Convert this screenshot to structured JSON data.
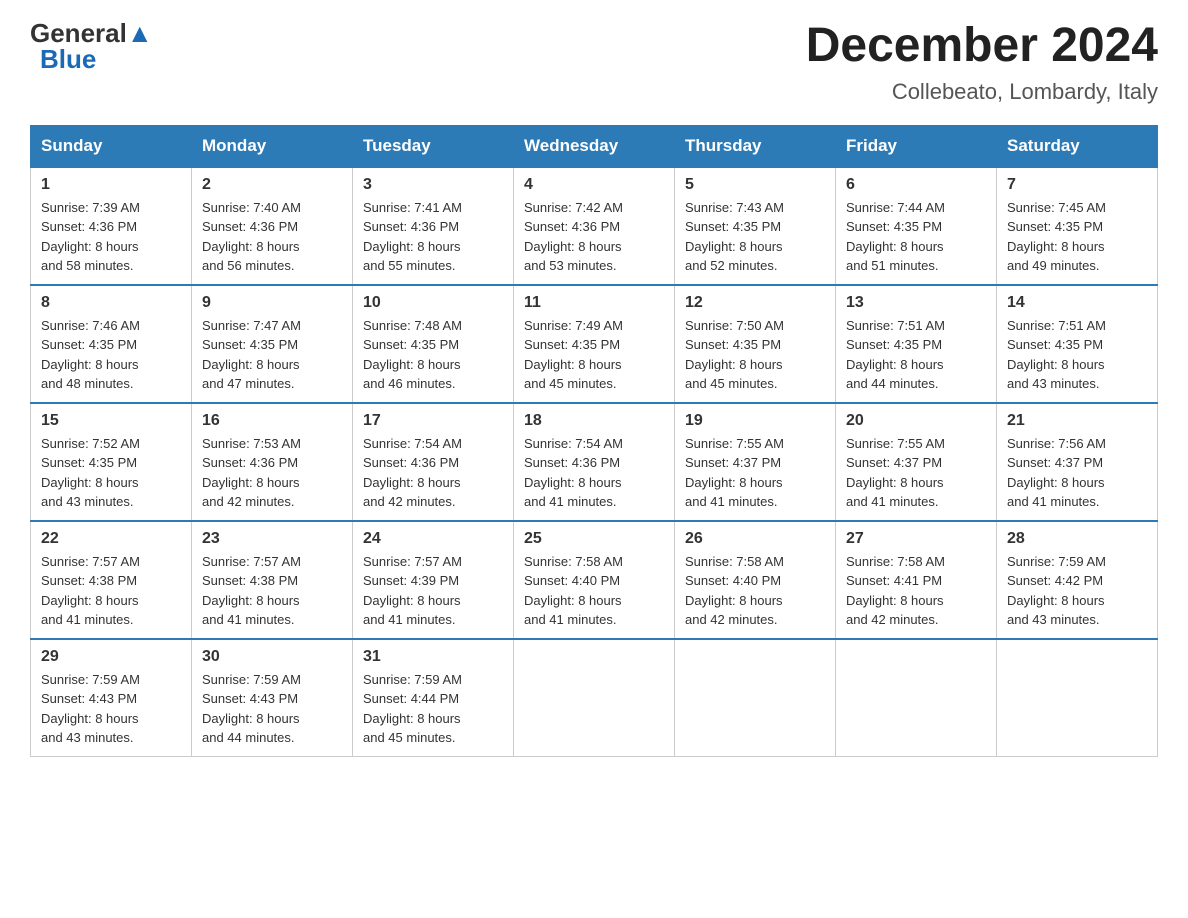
{
  "header": {
    "logo_general": "General",
    "logo_blue": "Blue",
    "month_title": "December 2024",
    "location": "Collebeato, Lombardy, Italy"
  },
  "weekdays": [
    "Sunday",
    "Monday",
    "Tuesday",
    "Wednesday",
    "Thursday",
    "Friday",
    "Saturday"
  ],
  "weeks": [
    [
      {
        "day": "1",
        "sunrise": "7:39 AM",
        "sunset": "4:36 PM",
        "daylight": "8 hours and 58 minutes."
      },
      {
        "day": "2",
        "sunrise": "7:40 AM",
        "sunset": "4:36 PM",
        "daylight": "8 hours and 56 minutes."
      },
      {
        "day": "3",
        "sunrise": "7:41 AM",
        "sunset": "4:36 PM",
        "daylight": "8 hours and 55 minutes."
      },
      {
        "day": "4",
        "sunrise": "7:42 AM",
        "sunset": "4:36 PM",
        "daylight": "8 hours and 53 minutes."
      },
      {
        "day": "5",
        "sunrise": "7:43 AM",
        "sunset": "4:35 PM",
        "daylight": "8 hours and 52 minutes."
      },
      {
        "day": "6",
        "sunrise": "7:44 AM",
        "sunset": "4:35 PM",
        "daylight": "8 hours and 51 minutes."
      },
      {
        "day": "7",
        "sunrise": "7:45 AM",
        "sunset": "4:35 PM",
        "daylight": "8 hours and 49 minutes."
      }
    ],
    [
      {
        "day": "8",
        "sunrise": "7:46 AM",
        "sunset": "4:35 PM",
        "daylight": "8 hours and 48 minutes."
      },
      {
        "day": "9",
        "sunrise": "7:47 AM",
        "sunset": "4:35 PM",
        "daylight": "8 hours and 47 minutes."
      },
      {
        "day": "10",
        "sunrise": "7:48 AM",
        "sunset": "4:35 PM",
        "daylight": "8 hours and 46 minutes."
      },
      {
        "day": "11",
        "sunrise": "7:49 AM",
        "sunset": "4:35 PM",
        "daylight": "8 hours and 45 minutes."
      },
      {
        "day": "12",
        "sunrise": "7:50 AM",
        "sunset": "4:35 PM",
        "daylight": "8 hours and 45 minutes."
      },
      {
        "day": "13",
        "sunrise": "7:51 AM",
        "sunset": "4:35 PM",
        "daylight": "8 hours and 44 minutes."
      },
      {
        "day": "14",
        "sunrise": "7:51 AM",
        "sunset": "4:35 PM",
        "daylight": "8 hours and 43 minutes."
      }
    ],
    [
      {
        "day": "15",
        "sunrise": "7:52 AM",
        "sunset": "4:35 PM",
        "daylight": "8 hours and 43 minutes."
      },
      {
        "day": "16",
        "sunrise": "7:53 AM",
        "sunset": "4:36 PM",
        "daylight": "8 hours and 42 minutes."
      },
      {
        "day": "17",
        "sunrise": "7:54 AM",
        "sunset": "4:36 PM",
        "daylight": "8 hours and 42 minutes."
      },
      {
        "day": "18",
        "sunrise": "7:54 AM",
        "sunset": "4:36 PM",
        "daylight": "8 hours and 41 minutes."
      },
      {
        "day": "19",
        "sunrise": "7:55 AM",
        "sunset": "4:37 PM",
        "daylight": "8 hours and 41 minutes."
      },
      {
        "day": "20",
        "sunrise": "7:55 AM",
        "sunset": "4:37 PM",
        "daylight": "8 hours and 41 minutes."
      },
      {
        "day": "21",
        "sunrise": "7:56 AM",
        "sunset": "4:37 PM",
        "daylight": "8 hours and 41 minutes."
      }
    ],
    [
      {
        "day": "22",
        "sunrise": "7:57 AM",
        "sunset": "4:38 PM",
        "daylight": "8 hours and 41 minutes."
      },
      {
        "day": "23",
        "sunrise": "7:57 AM",
        "sunset": "4:38 PM",
        "daylight": "8 hours and 41 minutes."
      },
      {
        "day": "24",
        "sunrise": "7:57 AM",
        "sunset": "4:39 PM",
        "daylight": "8 hours and 41 minutes."
      },
      {
        "day": "25",
        "sunrise": "7:58 AM",
        "sunset": "4:40 PM",
        "daylight": "8 hours and 41 minutes."
      },
      {
        "day": "26",
        "sunrise": "7:58 AM",
        "sunset": "4:40 PM",
        "daylight": "8 hours and 42 minutes."
      },
      {
        "day": "27",
        "sunrise": "7:58 AM",
        "sunset": "4:41 PM",
        "daylight": "8 hours and 42 minutes."
      },
      {
        "day": "28",
        "sunrise": "7:59 AM",
        "sunset": "4:42 PM",
        "daylight": "8 hours and 43 minutes."
      }
    ],
    [
      {
        "day": "29",
        "sunrise": "7:59 AM",
        "sunset": "4:43 PM",
        "daylight": "8 hours and 43 minutes."
      },
      {
        "day": "30",
        "sunrise": "7:59 AM",
        "sunset": "4:43 PM",
        "daylight": "8 hours and 44 minutes."
      },
      {
        "day": "31",
        "sunrise": "7:59 AM",
        "sunset": "4:44 PM",
        "daylight": "8 hours and 45 minutes."
      },
      null,
      null,
      null,
      null
    ]
  ],
  "labels": {
    "sunrise": "Sunrise:",
    "sunset": "Sunset:",
    "daylight": "Daylight:"
  }
}
